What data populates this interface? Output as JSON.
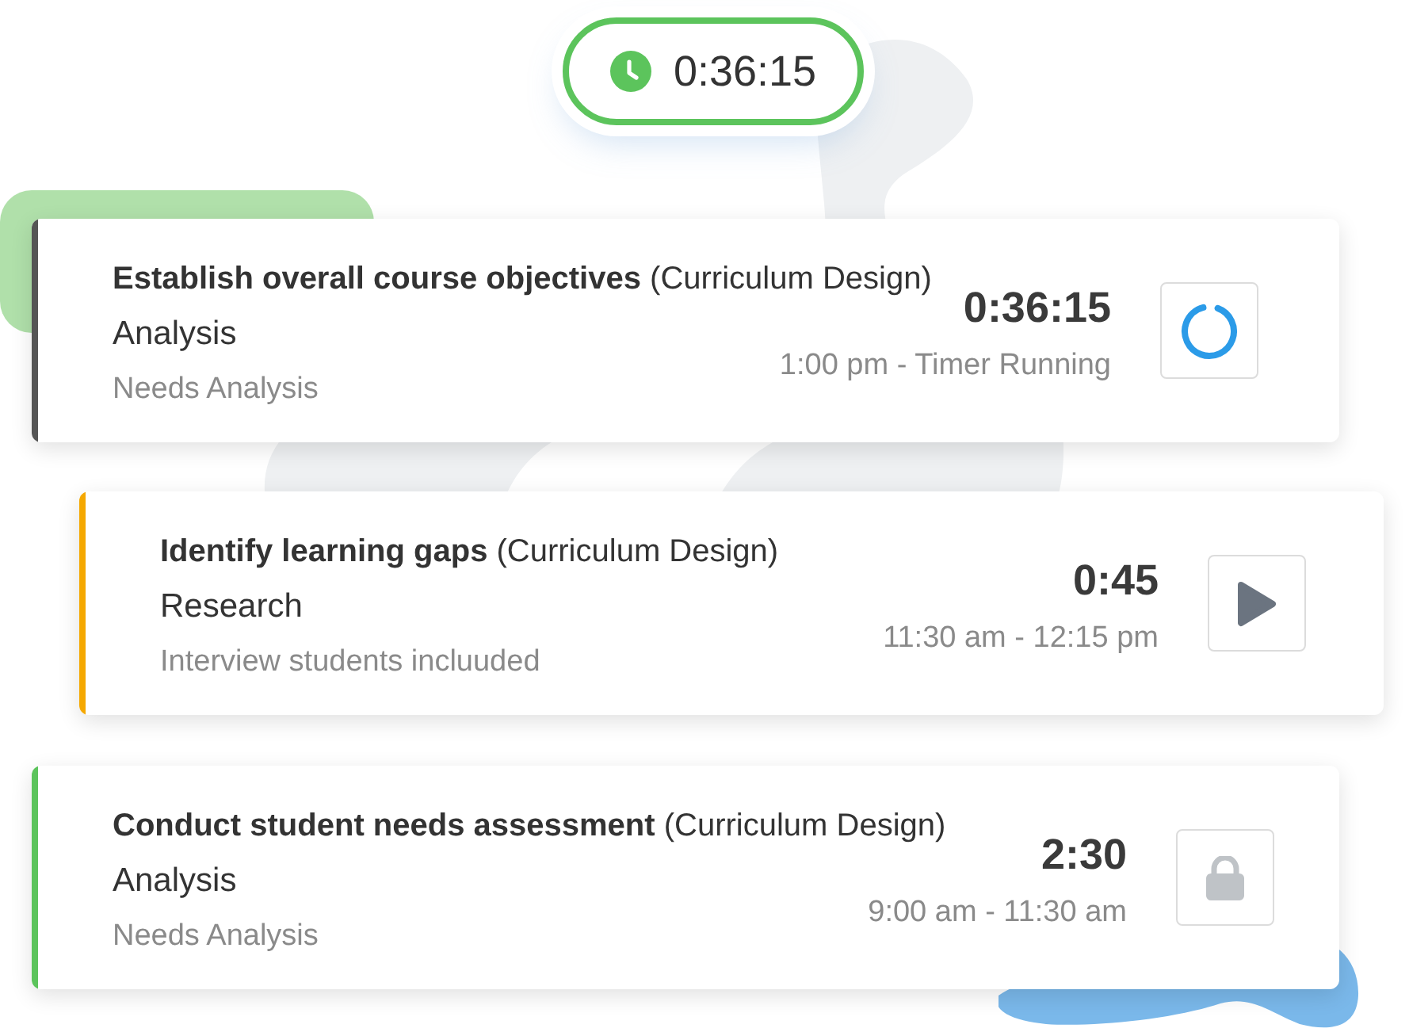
{
  "timer": {
    "time": "0:36:15"
  },
  "tasks": [
    {
      "kind": "running",
      "color": "#555555",
      "title": "**Establish overall course objectives** (Curriculum Design)",
      "category": "Analysis",
      "note": "Needs Analysis",
      "duration": "0:36:15",
      "time_range": "1:00 pm - Timer Running"
    },
    {
      "kind": "play",
      "color": "#f5a800",
      "title": "**Identify learning gaps** (Curriculum Design)",
      "category": "Research",
      "note": "Interview students incluuded",
      "duration": "0:45",
      "time_range": "11:30 am - 12:15 pm"
    },
    {
      "kind": "locked",
      "color": "#5cc45c",
      "title": "**Conduct student needs assessment** (Curriculum Design)",
      "category": "Analysis",
      "note": "Needs Analysis",
      "duration": "2:30",
      "time_range": "9:00 am - 11:30 am"
    }
  ]
}
